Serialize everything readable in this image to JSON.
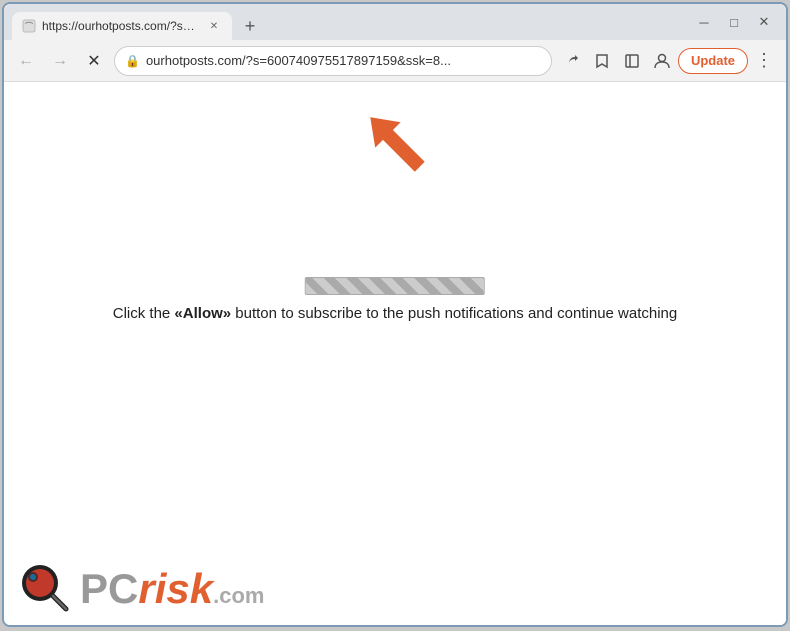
{
  "browser": {
    "title_bar": {
      "tab_title": "https://ourhotposts.com/?s=600",
      "new_tab_label": "+",
      "minimize_label": "─",
      "maximize_label": "□",
      "close_label": "✕"
    },
    "nav_bar": {
      "back_label": "←",
      "forward_label": "→",
      "reload_label": "✕",
      "address": "ourhotposts.com/?s=600740975517897159&ssk=8...",
      "update_label": "Update",
      "menu_label": "⋮"
    }
  },
  "content": {
    "progress_bar_visible": true,
    "subscribe_text_1": "Click the ",
    "allow_text": "«Allow»",
    "subscribe_text_2": " button to subscribe to the push notifications and continue watching"
  },
  "logo": {
    "pc_text": "PC",
    "risk_text": "risk",
    "dotcom_text": ".com"
  },
  "icons": {
    "lock": "🔒",
    "share": "⎋",
    "bookmark": "☆",
    "sidebar": "▣",
    "profile": "👤",
    "more": "⋮"
  }
}
